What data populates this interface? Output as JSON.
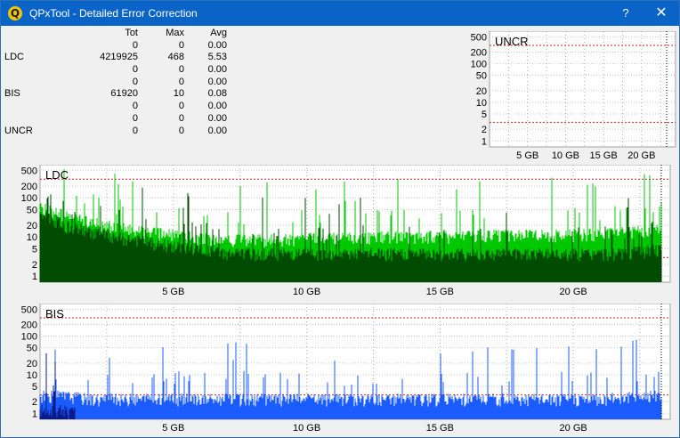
{
  "window": {
    "title": "QPxTool - Detailed Error Correction",
    "help_label": "?",
    "close_label": "✕",
    "app_icon_letter": "Q"
  },
  "stats": {
    "headers": [
      "",
      "Tot",
      "Max",
      "Avg"
    ],
    "rows": [
      {
        "label": "",
        "tot": "0",
        "max": "0",
        "avg": "0.00"
      },
      {
        "label": "LDC",
        "tot": "4219925",
        "max": "468",
        "avg": "5.53"
      },
      {
        "label": "",
        "tot": "0",
        "max": "0",
        "avg": "0.00"
      },
      {
        "label": "",
        "tot": "0",
        "max": "0",
        "avg": "0.00"
      },
      {
        "label": "BIS",
        "tot": "61920",
        "max": "10",
        "avg": "0.08"
      },
      {
        "label": "",
        "tot": "0",
        "max": "0",
        "avg": "0.00"
      },
      {
        "label": "",
        "tot": "0",
        "max": "0",
        "avg": "0.00"
      },
      {
        "label": "UNCR",
        "tot": "0",
        "max": "0",
        "avg": "0.00"
      }
    ]
  },
  "chart_data": [
    {
      "type": "area",
      "title": "UNCR",
      "y_scale": "log",
      "y_ticks": [
        "500",
        "200",
        "100",
        "50",
        "20",
        "10",
        "5",
        "2",
        "1"
      ],
      "x_ticks": [
        "5 GB",
        "10 GB",
        "15 GB",
        "20 GB"
      ],
      "x_tick_values_gb": [
        5,
        10,
        15,
        20
      ],
      "xlim_gb": [
        0,
        23.3
      ],
      "threshold_lines": [
        300,
        3
      ],
      "end_marker_gb": 23.3,
      "series": [
        {
          "color": "#00b000",
          "values": []
        }
      ]
    },
    {
      "type": "area",
      "title": "LDC",
      "y_scale": "log",
      "y_ticks": [
        "500",
        "200",
        "100",
        "50",
        "20",
        "10",
        "5",
        "2",
        "1"
      ],
      "x_ticks": [
        "5 GB",
        "10 GB",
        "15 GB",
        "20 GB"
      ],
      "x_tick_values_gb": [
        5,
        10,
        15,
        20
      ],
      "xlim_gb": [
        0,
        23.3
      ],
      "threshold_lines": [
        300,
        3
      ],
      "end_marker_gb": 23.3,
      "max": 468,
      "avg": 5.53,
      "series": [
        {
          "color": "#00c800",
          "gb": [
            0,
            1,
            2,
            3,
            4,
            5,
            6,
            7,
            8,
            9,
            10,
            11,
            12,
            13,
            14,
            15,
            16,
            17,
            18,
            19,
            20,
            21,
            22,
            23
          ],
          "values": [
            60,
            35,
            25,
            18,
            14,
            12,
            10,
            9,
            9,
            9,
            10,
            10,
            10,
            11,
            11,
            11,
            11,
            12,
            12,
            12,
            12,
            13,
            14,
            16
          ]
        },
        {
          "color": "#004c00",
          "gb": [
            0,
            1,
            2,
            3,
            4,
            5,
            6,
            7,
            8,
            9,
            10,
            11,
            12,
            13,
            14,
            15,
            16,
            17,
            18,
            19,
            20,
            21,
            22,
            23
          ],
          "values": [
            40,
            20,
            14,
            10,
            8,
            6,
            5,
            4,
            4,
            4,
            4,
            4,
            4,
            4,
            4,
            4,
            4,
            4,
            4,
            4,
            4,
            4,
            4,
            5
          ]
        }
      ]
    },
    {
      "type": "area",
      "title": "BIS",
      "y_scale": "log",
      "y_ticks": [
        "500",
        "200",
        "100",
        "50",
        "20",
        "10",
        "5",
        "2",
        "1"
      ],
      "x_ticks": [
        "5 GB",
        "10 GB",
        "15 GB",
        "20 GB"
      ],
      "x_tick_values_gb": [
        5,
        10,
        15,
        20
      ],
      "xlim_gb": [
        0,
        23.3
      ],
      "threshold_lines": [
        300,
        3
      ],
      "end_marker_gb": 23.3,
      "max": 10,
      "avg": 0.08,
      "series": [
        {
          "color": "#1a5cff",
          "gb": [
            0,
            1,
            2,
            3,
            4,
            5,
            6,
            7,
            8,
            9,
            10,
            11,
            12,
            13,
            14,
            15,
            16,
            17,
            18,
            19,
            20,
            21,
            22,
            23
          ],
          "values": [
            3,
            3,
            2.5,
            2.5,
            2.5,
            2.5,
            2.5,
            2.5,
            2.5,
            2.5,
            2.5,
            2.5,
            2.5,
            2.5,
            2.5,
            2.5,
            2.5,
            2.5,
            2.5,
            2.5,
            2.5,
            2.5,
            3,
            3
          ]
        },
        {
          "color": "#0a1a8a",
          "gb": [
            0,
            0.5,
            1
          ],
          "values": [
            1.3,
            1.3,
            1.3
          ]
        }
      ]
    }
  ]
}
